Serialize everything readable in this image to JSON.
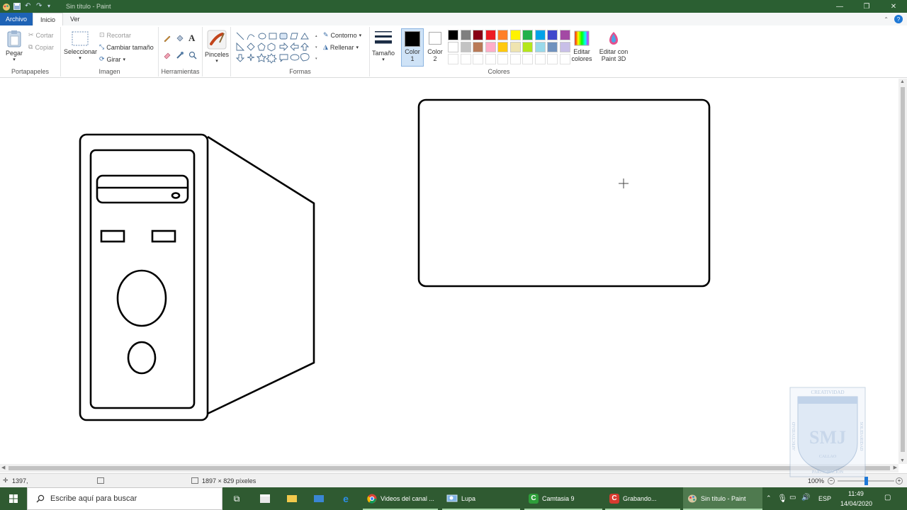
{
  "window": {
    "title": "Sin título - Paint",
    "controls": [
      "—",
      "❐",
      "✕"
    ]
  },
  "tabs": {
    "file": "Archivo",
    "home": "Inicio",
    "view": "Ver"
  },
  "ribbon": {
    "clipboard": {
      "paste": "Pegar",
      "cut": "Cortar",
      "copy": "Copiar",
      "label": "Portapapeles"
    },
    "image": {
      "select": "Seleccionar",
      "crop": "Recortar",
      "resize": "Cambiar tamaño",
      "rotate": "Girar",
      "label": "Imagen"
    },
    "tools": {
      "label": "Herramientas",
      "text_tool": "A"
    },
    "brushes": {
      "label": "Pinceles"
    },
    "shapes": {
      "outline": "Contorno",
      "fill": "Rellenar",
      "label": "Formas"
    },
    "size": {
      "label": "Tamaño"
    },
    "colors": {
      "color1": "Color",
      "color1_num": "1",
      "color2": "Color",
      "color2_num": "2",
      "edit": "Editar",
      "edit2": "colores",
      "paint3d": "Editar con",
      "paint3d2": "Paint 3D",
      "label": "Colores",
      "color1_value": "#000000",
      "color2_value": "#ffffff",
      "palette_row1": [
        "#000000",
        "#7f7f7f",
        "#880015",
        "#ed1c24",
        "#ff7f27",
        "#fff200",
        "#22b14c",
        "#00a2e8",
        "#3f48cc",
        "#a349a4"
      ],
      "palette_row2": [
        "#ffffff",
        "#c3c3c3",
        "#b97a57",
        "#ffaec9",
        "#ffc90e",
        "#efe4b0",
        "#b5e61d",
        "#99d9ea",
        "#7092be",
        "#c8bfe7"
      ]
    }
  },
  "status": {
    "cursor_pos": "1397,",
    "canvas_size": "1897 × 829 píxeles",
    "zoom": "100%"
  },
  "taskbar": {
    "search_placeholder": "Escribe aquí para buscar",
    "apps": [
      {
        "label": "Videos del canal ...",
        "icon": "chrome-icon"
      },
      {
        "label": "Lupa",
        "icon": "magnifier-icon"
      },
      {
        "label": "Camtasia 9",
        "icon": "camtasia-icon"
      },
      {
        "label": "Grabando...",
        "icon": "camtasia-recorder-icon"
      },
      {
        "label": "Sin título - Paint",
        "icon": "paint-icon"
      }
    ],
    "lang": "ESP",
    "time": "11:49",
    "date": "14/04/2020"
  },
  "watermark": {
    "top": "CREATIVIDAD",
    "left": "AFECTIVIDAD",
    "right": "SOLIDARIDAD",
    "mono": "SMJ",
    "city": "CALLAO",
    "bottom": "PARTICIPACIÓN"
  }
}
